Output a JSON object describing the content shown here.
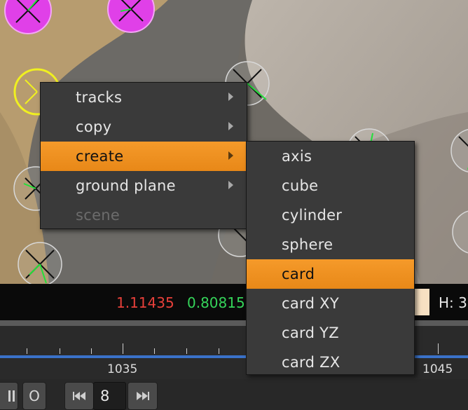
{
  "info": {
    "red_value": "1.11435",
    "green_value": "0.80815",
    "h_label": "H: 3",
    "red_color": "#e8403a",
    "green_color": "#35d45a"
  },
  "timeline": {
    "labels": [
      "1035",
      "1045"
    ],
    "line_color": "#3a72c9"
  },
  "controls": {
    "o_label": "O",
    "frame_value": "8"
  },
  "context_menu": {
    "items": [
      {
        "label": "tracks",
        "submenu": true,
        "highlighted": false,
        "disabled": false
      },
      {
        "label": "copy",
        "submenu": true,
        "highlighted": false,
        "disabled": false
      },
      {
        "label": "create",
        "submenu": true,
        "highlighted": true,
        "disabled": false
      },
      {
        "label": "ground plane",
        "submenu": true,
        "highlighted": false,
        "disabled": false
      },
      {
        "label": "scene",
        "submenu": false,
        "highlighted": false,
        "disabled": true
      }
    ]
  },
  "create_submenu": {
    "items": [
      {
        "label": "axis",
        "highlighted": false
      },
      {
        "label": "cube",
        "highlighted": false
      },
      {
        "label": "cylinder",
        "highlighted": false
      },
      {
        "label": "sphere",
        "highlighted": false
      },
      {
        "label": "card",
        "highlighted": true
      },
      {
        "label": "card XY",
        "highlighted": false
      },
      {
        "label": "card YZ",
        "highlighted": false
      },
      {
        "label": "card ZX",
        "highlighted": false
      }
    ]
  },
  "colors": {
    "highlight": "#f29224",
    "menu_bg": "#3a3a3a",
    "marker_magenta": "#e040e8",
    "marker_yellow": "#f0f020",
    "marker_green": "#22e03a"
  }
}
